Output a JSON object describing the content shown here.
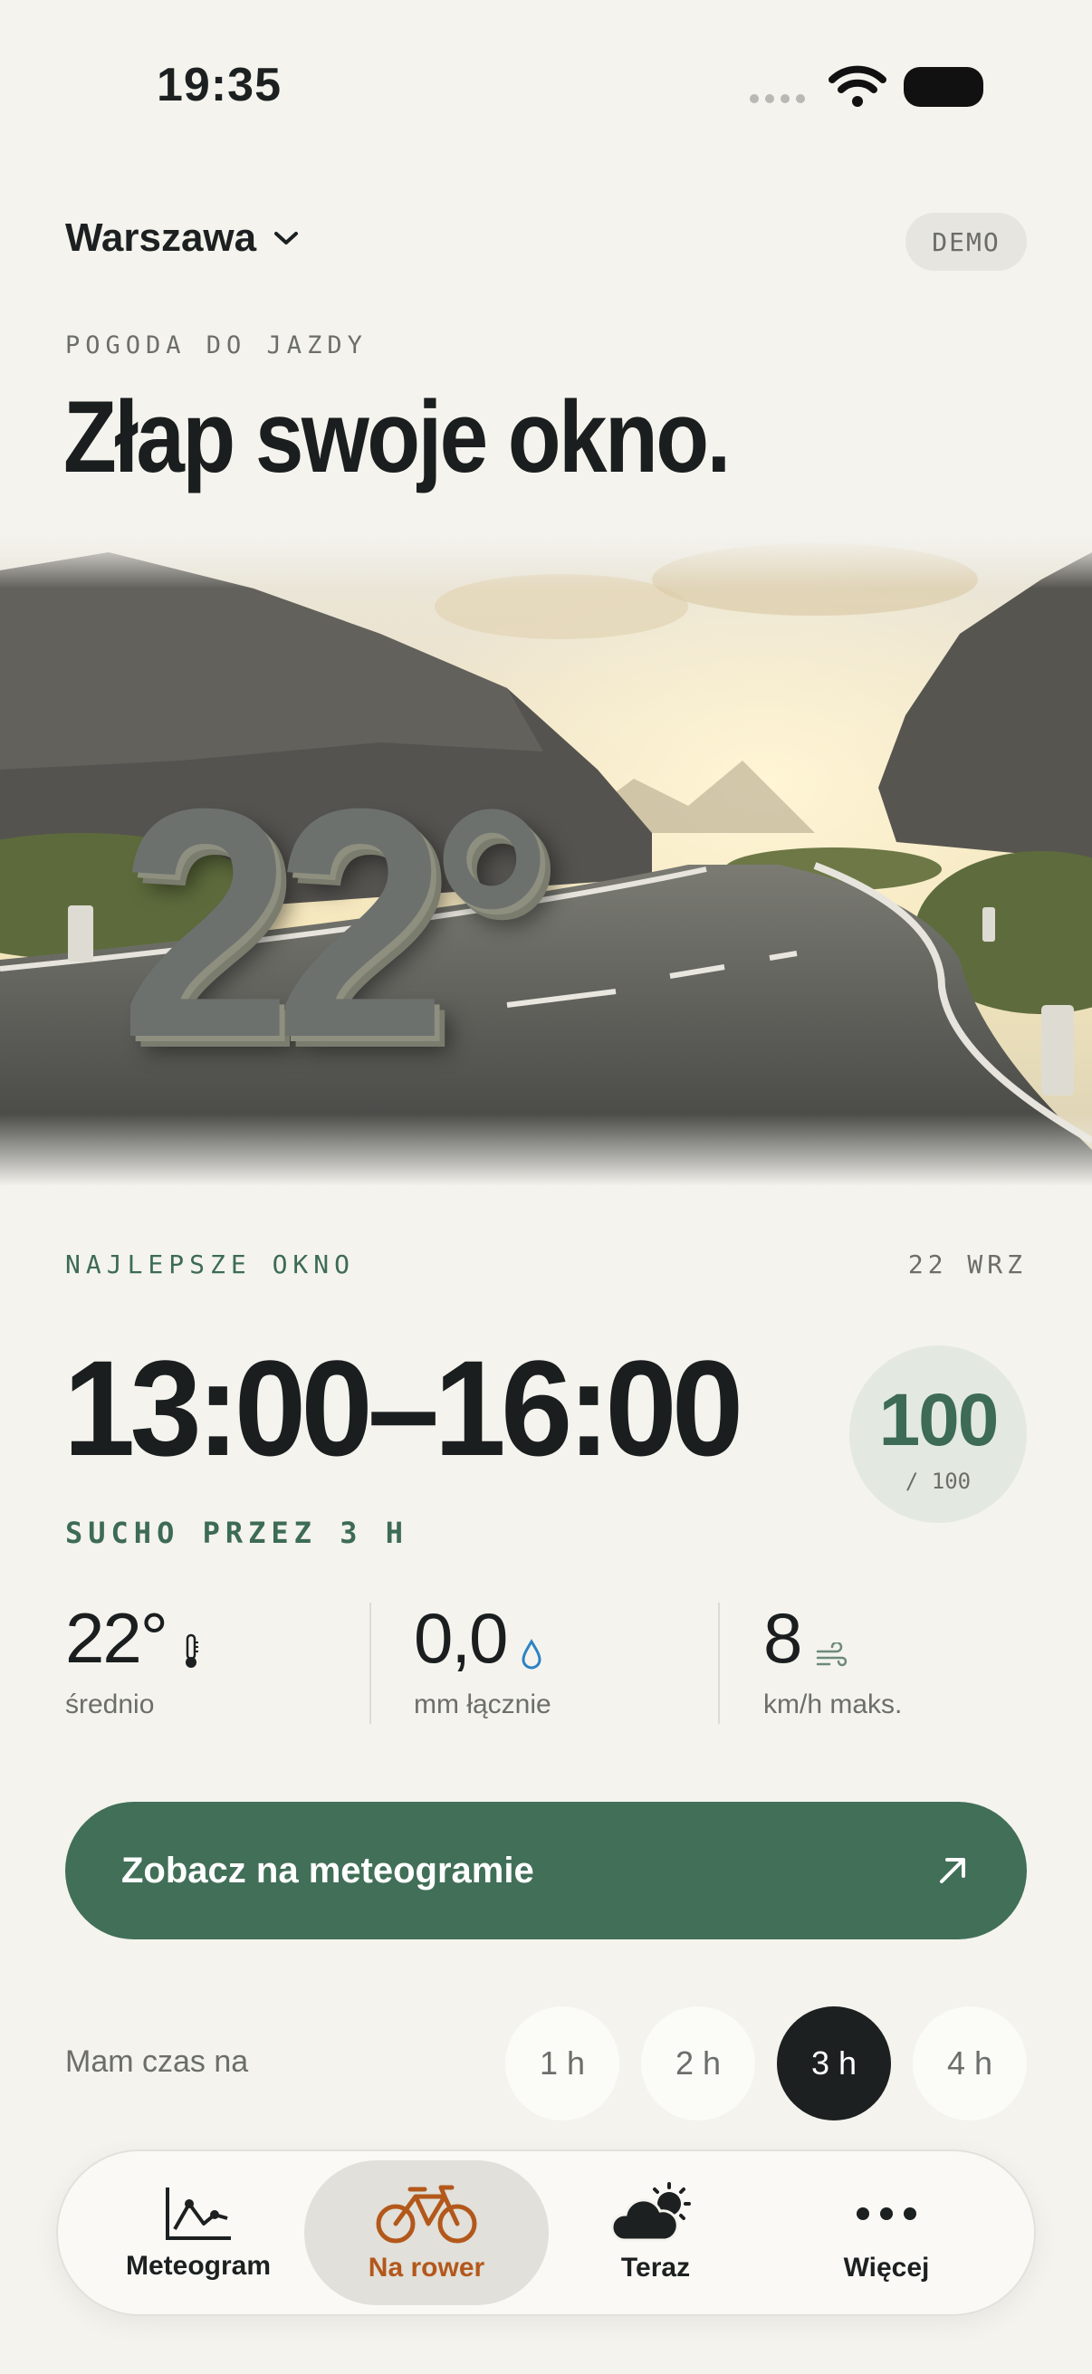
{
  "status_bar": {
    "time": "19:35"
  },
  "header": {
    "city": "Warszawa",
    "badge": "DEMO",
    "eyebrow": "POGODA DO JAZDY",
    "headline": "Złap swoje okno."
  },
  "hero": {
    "temperature": "22°"
  },
  "best_window": {
    "label": "NAJLEPSZE OKNO",
    "date": "22 WRZ",
    "range": "13:00–16:00",
    "score": "100",
    "score_max": "/ 100",
    "dry_label": "SUCHO PRZEZ 3 H"
  },
  "stats": [
    {
      "value": "22°",
      "label": "średnio",
      "icon": "thermometer-icon"
    },
    {
      "value": "0,0",
      "label": "mm łącznie",
      "icon": "raindrop-icon"
    },
    {
      "value": "8",
      "label": "km/h maks.",
      "icon": "wind-icon"
    }
  ],
  "cta": {
    "label": "Zobacz na meteogramie",
    "icon": "arrow-up-right-icon"
  },
  "duration": {
    "label": "Mam czas na",
    "options": [
      "1 h",
      "2 h",
      "3 h",
      "4 h"
    ],
    "selected": "3 h"
  },
  "tabs": [
    {
      "label": "Meteogram",
      "icon": "chart-line-icon"
    },
    {
      "label": "Na rower",
      "icon": "bicycle-icon",
      "active": true
    },
    {
      "label": "Teraz",
      "icon": "sun-cloud-icon"
    },
    {
      "label": "Więcej",
      "icon": "more-dots-icon"
    }
  ],
  "colors": {
    "background": "#f4f3ee",
    "accent_green": "#416f58",
    "active_tab": "#b3581b",
    "text_dark": "#1c2020"
  }
}
